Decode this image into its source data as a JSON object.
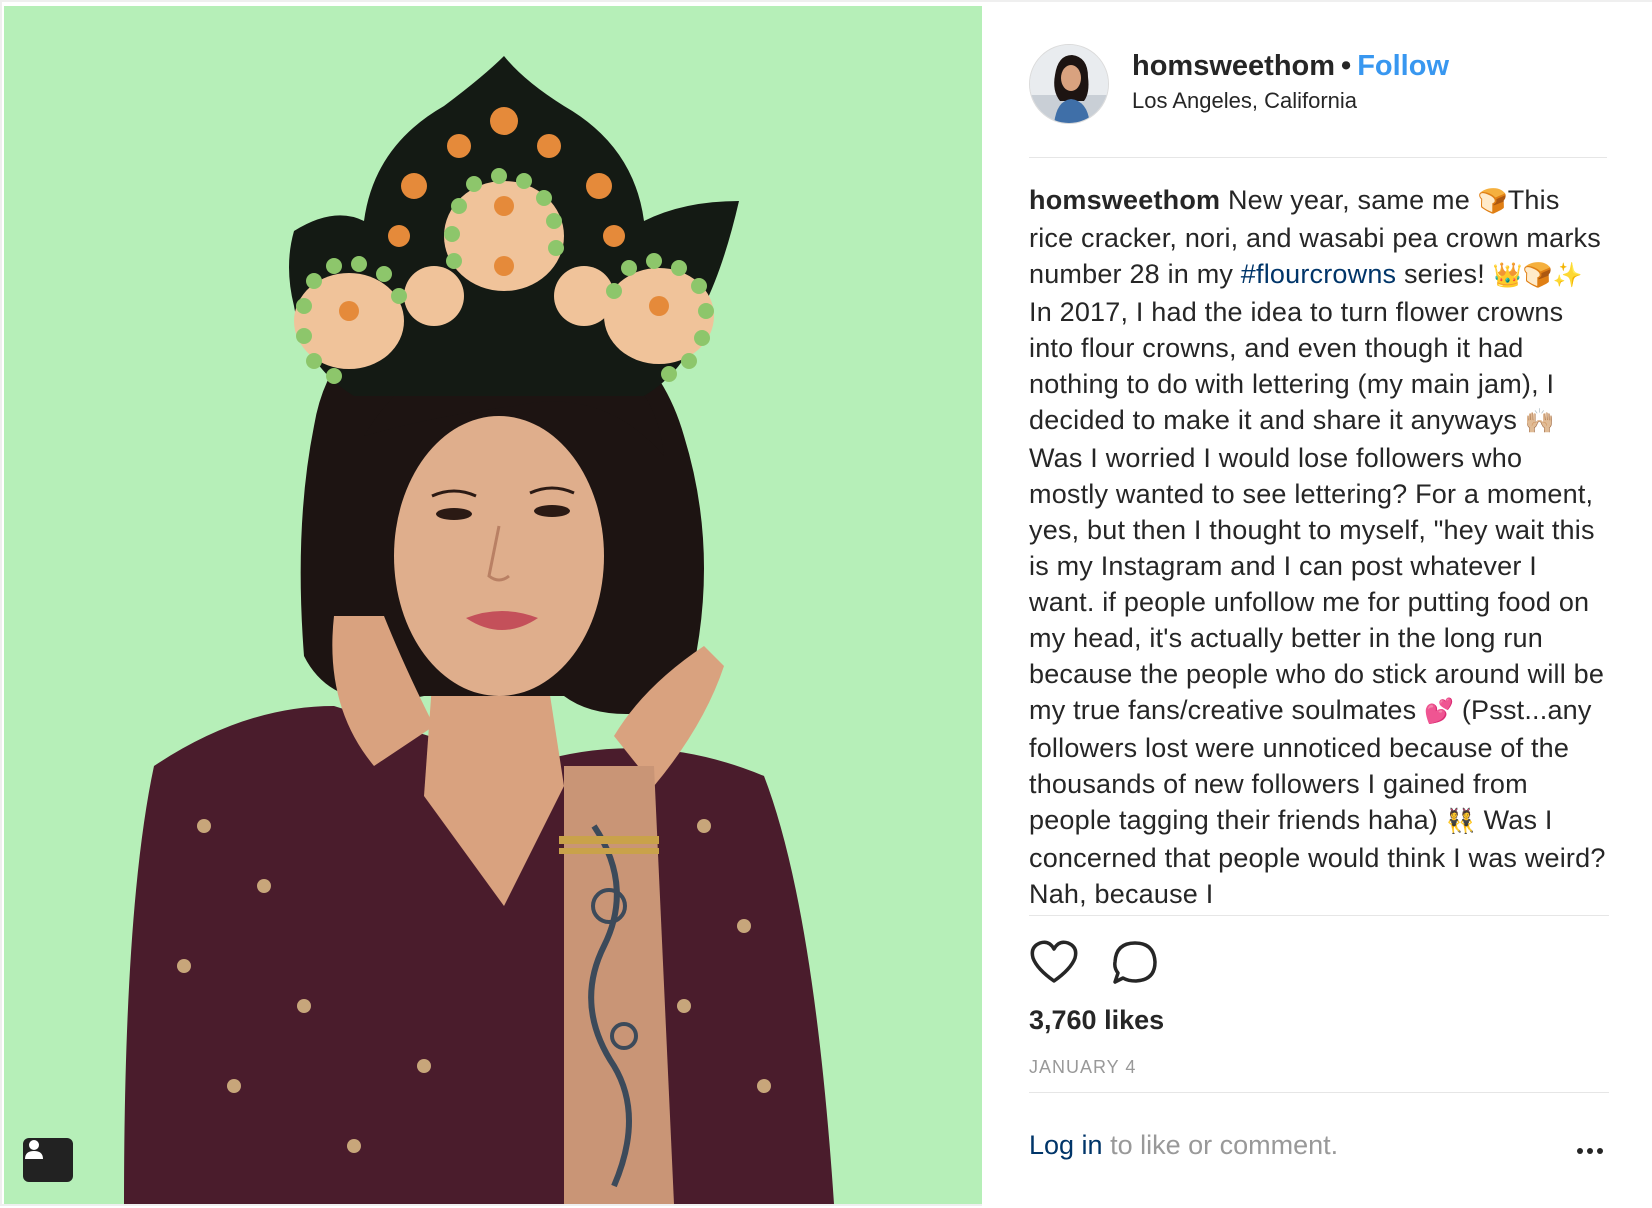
{
  "post": {
    "username": "homsweethom",
    "separator": "•",
    "follow_label": "Follow",
    "location": "Los Angeles, California",
    "caption": {
      "text_1": "New year, same me",
      "emoji_1": "🍞",
      "text_2": "This rice cracker, nori, and wasabi pea crown marks number 28 in my",
      "hashtag": "#flourcrowns",
      "text_3": "series!",
      "emoji_2": "👑🍞✨",
      "text_4": "In 2017, I had the idea to turn flower crowns into flour crowns, and even though it had nothing to do with lettering (my main jam), I decided to make it and share it anyways",
      "emoji_3": "🙌🏼",
      "text_5": "Was I worried I would lose followers who mostly wanted to see lettering? For a moment, yes, but then I thought to myself, \"hey wait this is my Instagram and I can post whatever I want. if people unfollow me for putting food on my head, it's actually better in the long run because the people who do stick around will be my true fans/creative soulmates",
      "emoji_4": "💕",
      "text_6": "(Psst...any followers lost were unnoticed because of the thousands of new followers I gained from people tagging their friends haha)",
      "emoji_5": "👯",
      "text_7": "Was I concerned that people would think I was weird? Nah, because I"
    },
    "likes": "3,760 likes",
    "date": "JANUARY 4",
    "login_link": "Log in",
    "login_rest": "to like or comment."
  },
  "icons": {
    "like": "heart-outline-icon",
    "comment": "comment-bubble-icon",
    "more": "more-options-icon",
    "tag": "user-tag-icon"
  },
  "colors": {
    "photo_background": "#b6efb8",
    "follow": "#3897f0",
    "hashtag": "#003569",
    "muted": "#999999"
  }
}
